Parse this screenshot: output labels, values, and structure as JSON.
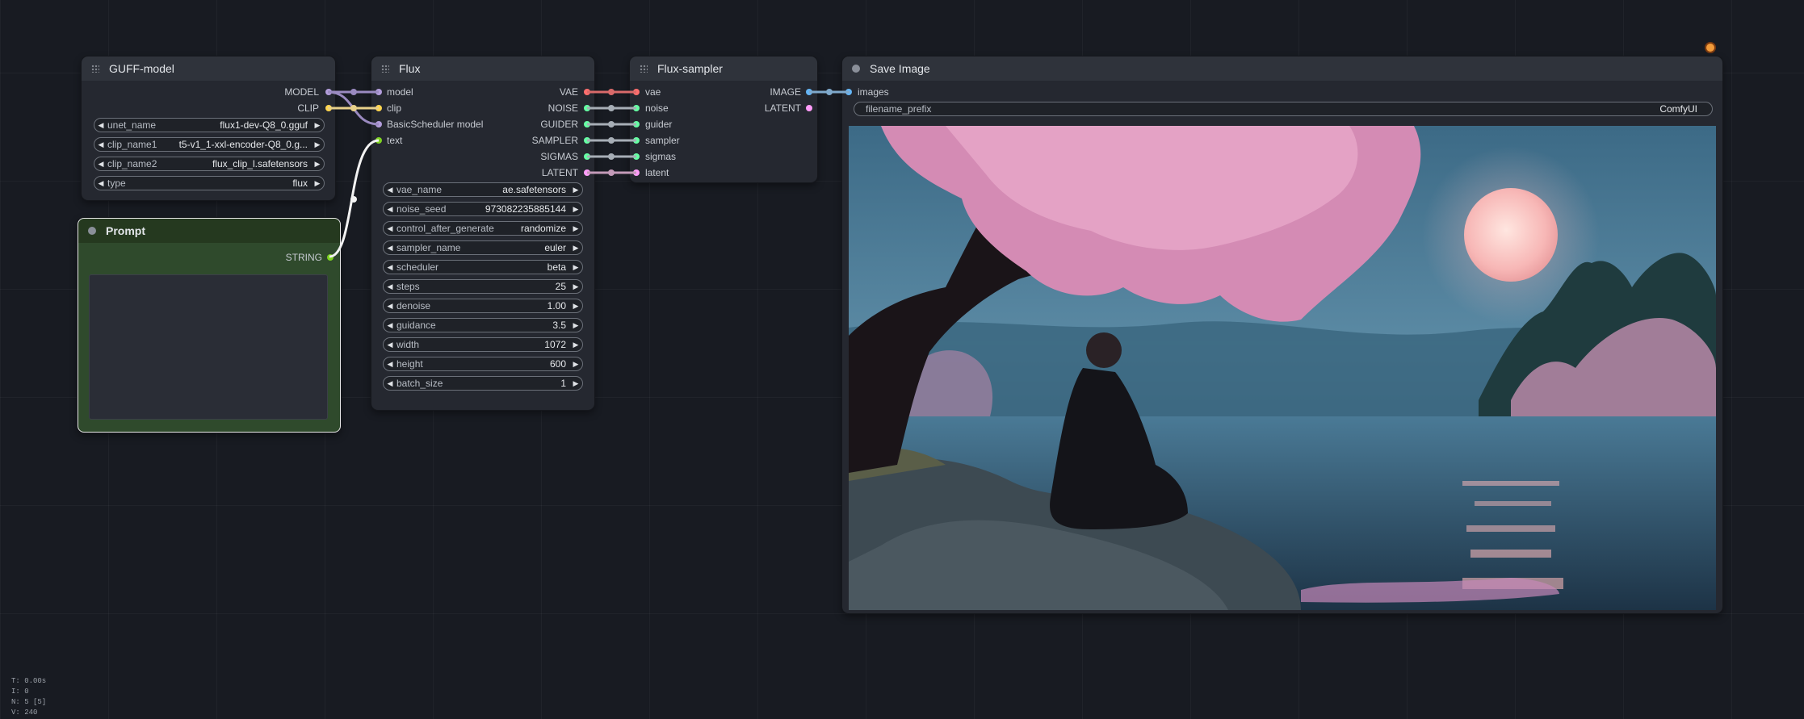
{
  "nodes": {
    "guff": {
      "title": "GUFF-model",
      "outputs": [
        "MODEL",
        "CLIP"
      ],
      "widgets": [
        {
          "label": "unet_name",
          "value": "flux1-dev-Q8_0.gguf"
        },
        {
          "label": "clip_name1",
          "value": "t5-v1_1-xxl-encoder-Q8_0.g..."
        },
        {
          "label": "clip_name2",
          "value": "flux_clip_l.safetensors"
        },
        {
          "label": "type",
          "value": "flux"
        }
      ]
    },
    "prompt": {
      "title": "Prompt",
      "output": "STRING",
      "text": ""
    },
    "flux": {
      "title": "Flux",
      "inputs": [
        "model",
        "clip",
        "BasicScheduler model",
        "text"
      ],
      "outputs": [
        "VAE",
        "NOISE",
        "GUIDER",
        "SAMPLER",
        "SIGMAS",
        "LATENT"
      ],
      "widgets": [
        {
          "label": "vae_name",
          "value": "ae.safetensors"
        },
        {
          "label": "noise_seed",
          "value": "973082235885144"
        },
        {
          "label": "control_after_generate",
          "value": "randomize"
        },
        {
          "label": "sampler_name",
          "value": "euler"
        },
        {
          "label": "scheduler",
          "value": "beta"
        },
        {
          "label": "steps",
          "value": "25"
        },
        {
          "label": "denoise",
          "value": "1.00"
        },
        {
          "label": "guidance",
          "value": "3.5"
        },
        {
          "label": "width",
          "value": "1072"
        },
        {
          "label": "height",
          "value": "600"
        },
        {
          "label": "batch_size",
          "value": "1"
        }
      ]
    },
    "sampler": {
      "title": "Flux-sampler",
      "inputs": [
        "vae",
        "noise",
        "guider",
        "sampler",
        "sigmas",
        "latent"
      ],
      "outputs": [
        "IMAGE",
        "LATENT"
      ]
    },
    "save": {
      "title": "Save Image",
      "inputs": [
        "images"
      ],
      "widget": {
        "label": "filename_prefix",
        "value": "ComfyUI"
      }
    }
  },
  "stats": [
    "T: 0.00s",
    "I: 0",
    "N: 5 [5]",
    "V: 240"
  ],
  "colors": {
    "model": "#b39ddb",
    "clip": "#ffd54f",
    "vae": "#ff6e6e",
    "noise": "#bfbfbf",
    "guider": "#66ffa4",
    "sampler": "#ecb4b4",
    "sigmas": "#cdffcd",
    "latent": "#ff9cf9",
    "image": "#64b5f6",
    "string": "#7ed321",
    "prompt_bg": "#354d2f"
  }
}
